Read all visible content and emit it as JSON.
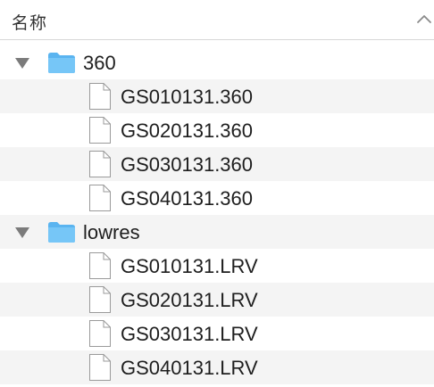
{
  "header": {
    "column_label": "名称",
    "sort_icon": "chevron-up-icon"
  },
  "colors": {
    "folder": "#5ab4f0",
    "alt_row": "#f4f4f4",
    "disclosure": "#7b7b7b"
  },
  "rows": [
    {
      "type": "folder",
      "name": "360",
      "expanded": true
    },
    {
      "type": "file",
      "name": "GS010131.360"
    },
    {
      "type": "file",
      "name": "GS020131.360"
    },
    {
      "type": "file",
      "name": "GS030131.360"
    },
    {
      "type": "file",
      "name": "GS040131.360"
    },
    {
      "type": "folder",
      "name": "lowres",
      "expanded": true
    },
    {
      "type": "file",
      "name": "GS010131.LRV"
    },
    {
      "type": "file",
      "name": "GS020131.LRV"
    },
    {
      "type": "file",
      "name": "GS030131.LRV"
    },
    {
      "type": "file",
      "name": "GS040131.LRV"
    }
  ]
}
